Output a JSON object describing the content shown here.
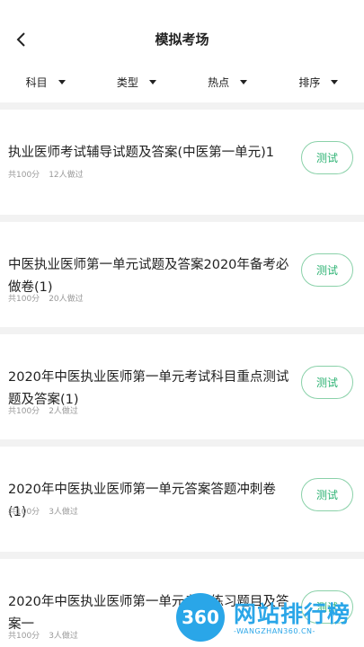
{
  "header": {
    "title": "模拟考场"
  },
  "filters": [
    {
      "label": "科目"
    },
    {
      "label": "类型"
    },
    {
      "label": "热点"
    },
    {
      "label": "排序"
    }
  ],
  "items": [
    {
      "title": "执业医师考试辅导试题及答案(中医第一单元)1",
      "score": "共100分",
      "count": "12人做过",
      "button": "测试"
    },
    {
      "title": "中医执业医师第一单元试题及答案2020年备考必做卷(1)",
      "score": "共100分",
      "count": "20人做过",
      "button": "测试"
    },
    {
      "title": "2020年中医执业医师第一单元考试科目重点测试题及答案(1)",
      "score": "共100分",
      "count": "2人做过",
      "button": "测试"
    },
    {
      "title": "2020年中医执业医师第一单元答案答题冲刺卷(1)",
      "score": "共100分",
      "count": "3人做过",
      "button": "测试"
    },
    {
      "title": "2020年中医执业医师第一单元考点练习题目及答案一",
      "score": "共100分",
      "count": "3人做过",
      "button": "测试"
    }
  ],
  "watermark": {
    "logo": "360",
    "text": "网站排行榜",
    "sub": "-WANGZHAN360.CN-"
  },
  "colors": {
    "accent": "#2bb272",
    "watermark": "#2aa6e8"
  }
}
